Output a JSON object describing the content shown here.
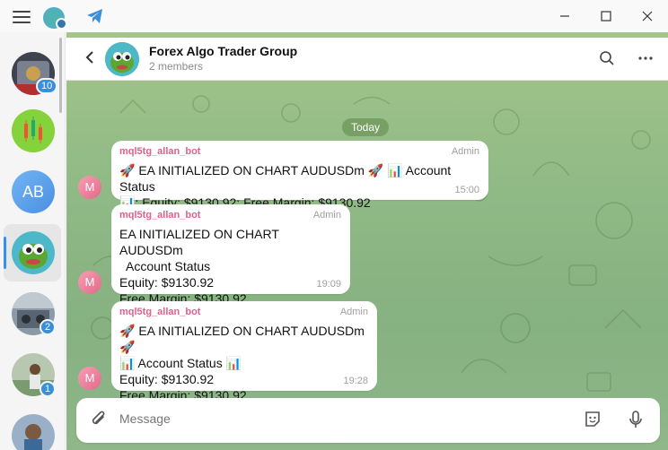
{
  "window": {
    "minimize_icon": "minimize-icon",
    "maximize_icon": "maximize-icon",
    "close_icon": "close-icon"
  },
  "sidebar": {
    "chats": [
      {
        "name": "chat-avatar-1",
        "badge": "10"
      },
      {
        "name": "chat-avatar-2",
        "badge": ""
      },
      {
        "name": "chat-avatar-ab",
        "initials": "AB",
        "badge": ""
      },
      {
        "name": "chat-avatar-forex-group",
        "badge": "",
        "active": true
      },
      {
        "name": "chat-avatar-5",
        "badge": "2"
      },
      {
        "name": "chat-avatar-6",
        "badge": "1"
      },
      {
        "name": "chat-avatar-7",
        "badge": ""
      }
    ]
  },
  "header": {
    "title": "Forex Algo Trader Group",
    "subtitle": "2 members"
  },
  "date_separator": "Today",
  "messages": [
    {
      "avatar_letter": "M",
      "sender": "mql5tg_allan_bot",
      "role": "Admin",
      "lines": [
        "🚀 EA INITIALIZED ON CHART AUDUSDm 🚀 📊  Account Status",
        "📊; Equity: $9130.92; Free Margin: $9130.92"
      ],
      "time": "15:00"
    },
    {
      "avatar_letter": "M",
      "sender": "mql5tg_allan_bot",
      "role": "Admin",
      "lines": [
        "EA INITIALIZED ON CHART AUDUSDm",
        "  Account Status",
        "Equity: $9130.92",
        "Free Margin: $9130.92"
      ],
      "time": "19:09"
    },
    {
      "avatar_letter": "M",
      "sender": "mql5tg_allan_bot",
      "role": "Admin",
      "lines": [
        "🚀 EA INITIALIZED ON CHART AUDUSDm🚀",
        "📊 Account Status 📊",
        "Equity: $9130.92",
        "Free Margin: $9130.92"
      ],
      "time": "19:28"
    }
  ],
  "composer": {
    "placeholder": "Message"
  },
  "colors": {
    "accent": "#3390ec",
    "sender": "#e0618b",
    "badge": "#3a8fd9"
  }
}
